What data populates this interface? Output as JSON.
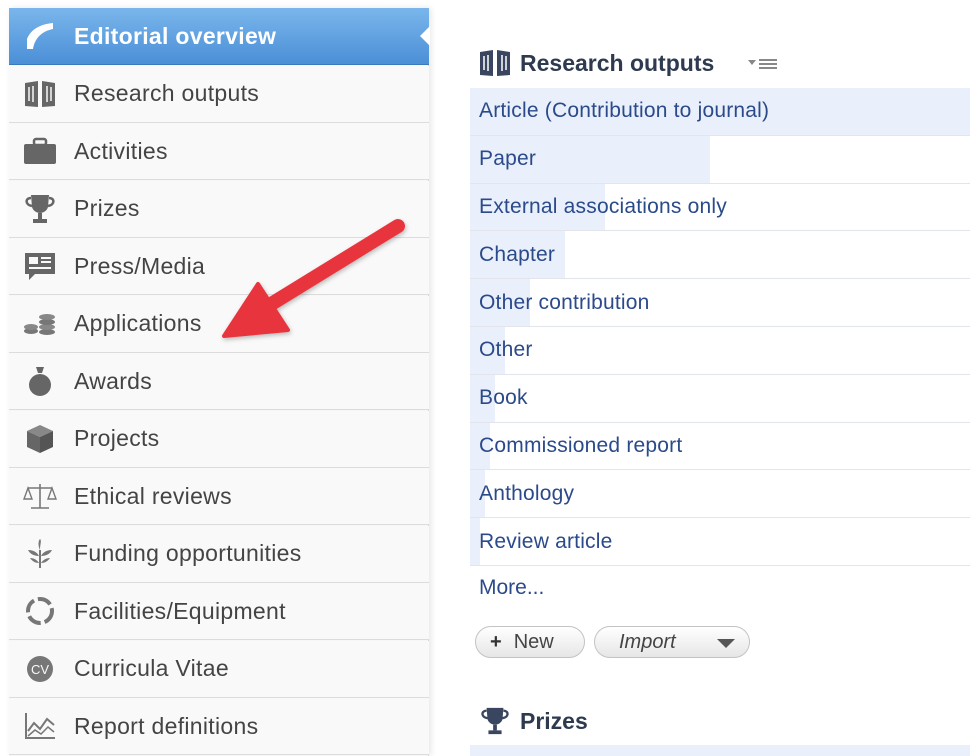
{
  "sidebar": {
    "items": [
      {
        "label": "Editorial overview",
        "icon": "editorial-icon",
        "active": true
      },
      {
        "label": "Research outputs",
        "icon": "book-icon"
      },
      {
        "label": "Activities",
        "icon": "briefcase-icon"
      },
      {
        "label": "Prizes",
        "icon": "trophy-icon"
      },
      {
        "label": "Press/Media",
        "icon": "press-icon"
      },
      {
        "label": "Applications",
        "icon": "coins-icon"
      },
      {
        "label": "Awards",
        "icon": "money-bag-icon"
      },
      {
        "label": "Projects",
        "icon": "cube-icon"
      },
      {
        "label": "Ethical reviews",
        "icon": "scales-icon"
      },
      {
        "label": "Funding opportunities",
        "icon": "sprout-icon"
      },
      {
        "label": "Facilities/Equipment",
        "icon": "ring-icon"
      },
      {
        "label": "Curricula Vitae",
        "icon": "cv-icon"
      },
      {
        "label": "Report definitions",
        "icon": "chart-icon"
      }
    ]
  },
  "main": {
    "research_outputs": {
      "title": "Research outputs",
      "rows": [
        {
          "label": "Article (Contribution to journal)",
          "share": 1.0
        },
        {
          "label": "Paper",
          "share": 0.48
        },
        {
          "label": "External associations only",
          "share": 0.27
        },
        {
          "label": "Chapter",
          "share": 0.19
        },
        {
          "label": "Other contribution",
          "share": 0.12
        },
        {
          "label": "Other",
          "share": 0.07
        },
        {
          "label": "Book",
          "share": 0.05
        },
        {
          "label": "Commissioned report",
          "share": 0.04
        },
        {
          "label": "Anthology",
          "share": 0.03
        },
        {
          "label": "Review article",
          "share": 0.02
        }
      ],
      "more_label": "More...",
      "new_button": "New",
      "new_icon": "+",
      "import_button": "Import"
    },
    "prizes": {
      "title": "Prizes"
    }
  },
  "colors": {
    "active_nav": "#4b8fd6",
    "link": "#2b4a8a",
    "row_bar": "#e9f0fb",
    "annotation_arrow": "#e8363d"
  }
}
